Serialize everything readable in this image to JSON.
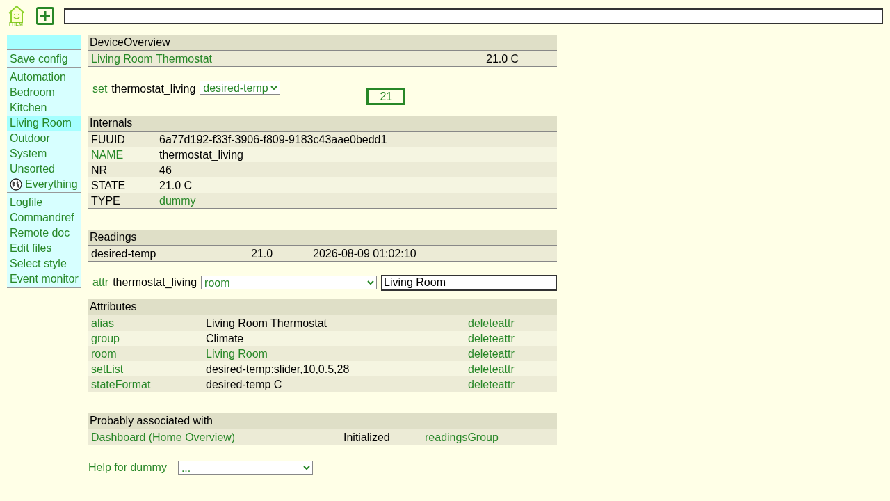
{
  "logo": {
    "text": "FHEM"
  },
  "sidebar": {
    "groups": [
      [
        {
          "label": "Save config",
          "selected": false,
          "kind": "link"
        }
      ],
      [
        {
          "label": "Automation",
          "selected": false,
          "kind": "link"
        },
        {
          "label": "Bedroom",
          "selected": false,
          "kind": "link"
        },
        {
          "label": "Kitchen",
          "selected": false,
          "kind": "link"
        },
        {
          "label": "Living Room",
          "selected": true,
          "kind": "link"
        },
        {
          "label": "Outdoor",
          "selected": false,
          "kind": "link"
        },
        {
          "label": "System",
          "selected": false,
          "kind": "link"
        },
        {
          "label": "Unsorted",
          "selected": false,
          "kind": "link"
        },
        {
          "label": "Everything",
          "selected": false,
          "kind": "globe"
        }
      ],
      [
        {
          "label": "Logfile",
          "selected": false,
          "kind": "link"
        },
        {
          "label": "Commandref",
          "selected": false,
          "kind": "link"
        },
        {
          "label": "Remote doc",
          "selected": false,
          "kind": "link"
        },
        {
          "label": "Edit files",
          "selected": false,
          "kind": "link"
        },
        {
          "label": "Select style",
          "selected": false,
          "kind": "link"
        },
        {
          "label": "Event monitor",
          "selected": false,
          "kind": "link"
        }
      ]
    ]
  },
  "overview": {
    "title": "DeviceOverview",
    "rows": [
      {
        "name": "Living Room Thermostat",
        "state": "21.0 C"
      }
    ]
  },
  "set": {
    "command": "set",
    "device": "thermostat_living",
    "option": "desired-temp",
    "value": "21"
  },
  "internals": {
    "title": "Internals",
    "rows": [
      {
        "name": "FUUID",
        "value": "6a77d192-f33f-3906-f809-9183c43aae0bedd1",
        "name_link": false,
        "value_link": false
      },
      {
        "name": "NAME",
        "value": "thermostat_living",
        "name_link": true,
        "value_link": false
      },
      {
        "name": "NR",
        "value": "46",
        "name_link": false,
        "value_link": false
      },
      {
        "name": "STATE",
        "value": "21.0 C",
        "name_link": false,
        "value_link": false
      },
      {
        "name": "TYPE",
        "value": "dummy",
        "name_link": false,
        "value_link": true
      }
    ]
  },
  "readings": {
    "title": "Readings",
    "rows": [
      {
        "name": "desired-temp",
        "value": "21.0",
        "time": "2026-08-09 01:02:10"
      }
    ]
  },
  "attr": {
    "command": "attr",
    "device": "thermostat_living",
    "option": "room",
    "value": "Living Room"
  },
  "attributes": {
    "title": "Attributes",
    "rows": [
      {
        "name": "alias",
        "value": "Living Room Thermostat",
        "value_link": false,
        "action": "deleteattr"
      },
      {
        "name": "group",
        "value": "Climate",
        "value_link": false,
        "action": "deleteattr"
      },
      {
        "name": "room",
        "value": "Living Room",
        "value_link": true,
        "action": "deleteattr"
      },
      {
        "name": "setList",
        "value": "desired-temp:slider,10,0.5,28",
        "value_link": false,
        "action": "deleteattr"
      },
      {
        "name": "stateFormat",
        "value": "desired-temp C",
        "value_link": false,
        "action": "deleteattr"
      }
    ]
  },
  "associated": {
    "title": "Probably associated with",
    "rows": [
      {
        "name": "Dashboard (Home Overview)",
        "state": "Initialized",
        "type": "readingsGroup"
      }
    ]
  },
  "help": {
    "label": "Help for dummy",
    "option": "..."
  }
}
